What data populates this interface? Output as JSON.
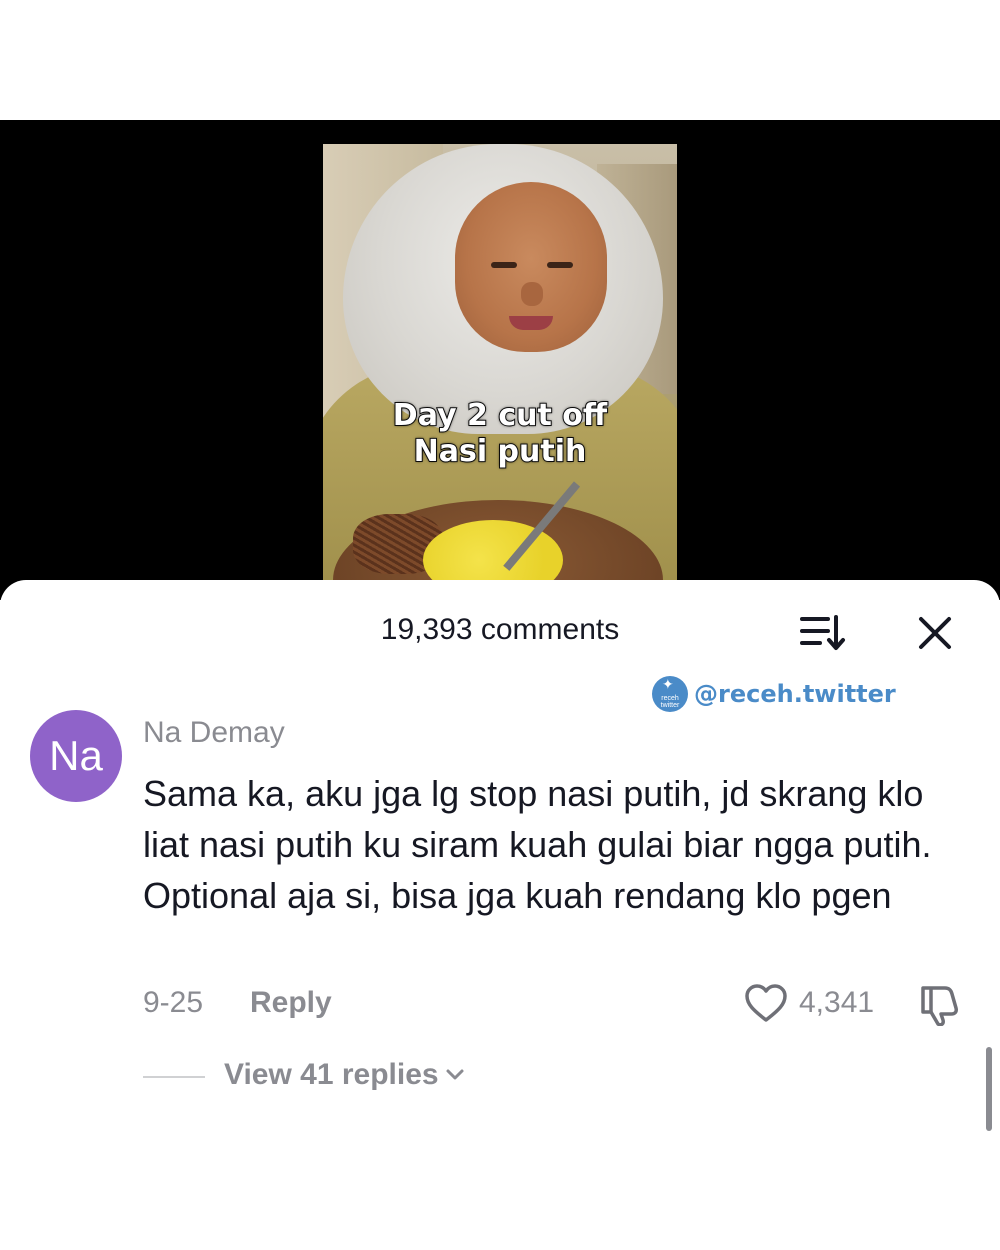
{
  "video": {
    "overlay_line1": "Day 2 cut off",
    "overlay_line2": "Nasi putih"
  },
  "comments_panel": {
    "count_label": "19,393 comments",
    "sort_icon": "sort-icon",
    "close_icon": "close-icon"
  },
  "watermark": {
    "logo_text": "receh twitter",
    "handle": "@receh.twitter"
  },
  "comment": {
    "avatar_initials": "Na",
    "avatar_color": "#8f63c9",
    "username": "Na Demay",
    "text": "Sama ka, aku jga lg stop nasi putih, jd skrang klo liat nasi putih ku siram kuah gulai biar ngga putih. Optional aja si, bisa jga kuah rendang klo pgen",
    "date": "9-25",
    "reply_label": "Reply",
    "likes": "4,341",
    "view_replies": "View 41 replies"
  }
}
